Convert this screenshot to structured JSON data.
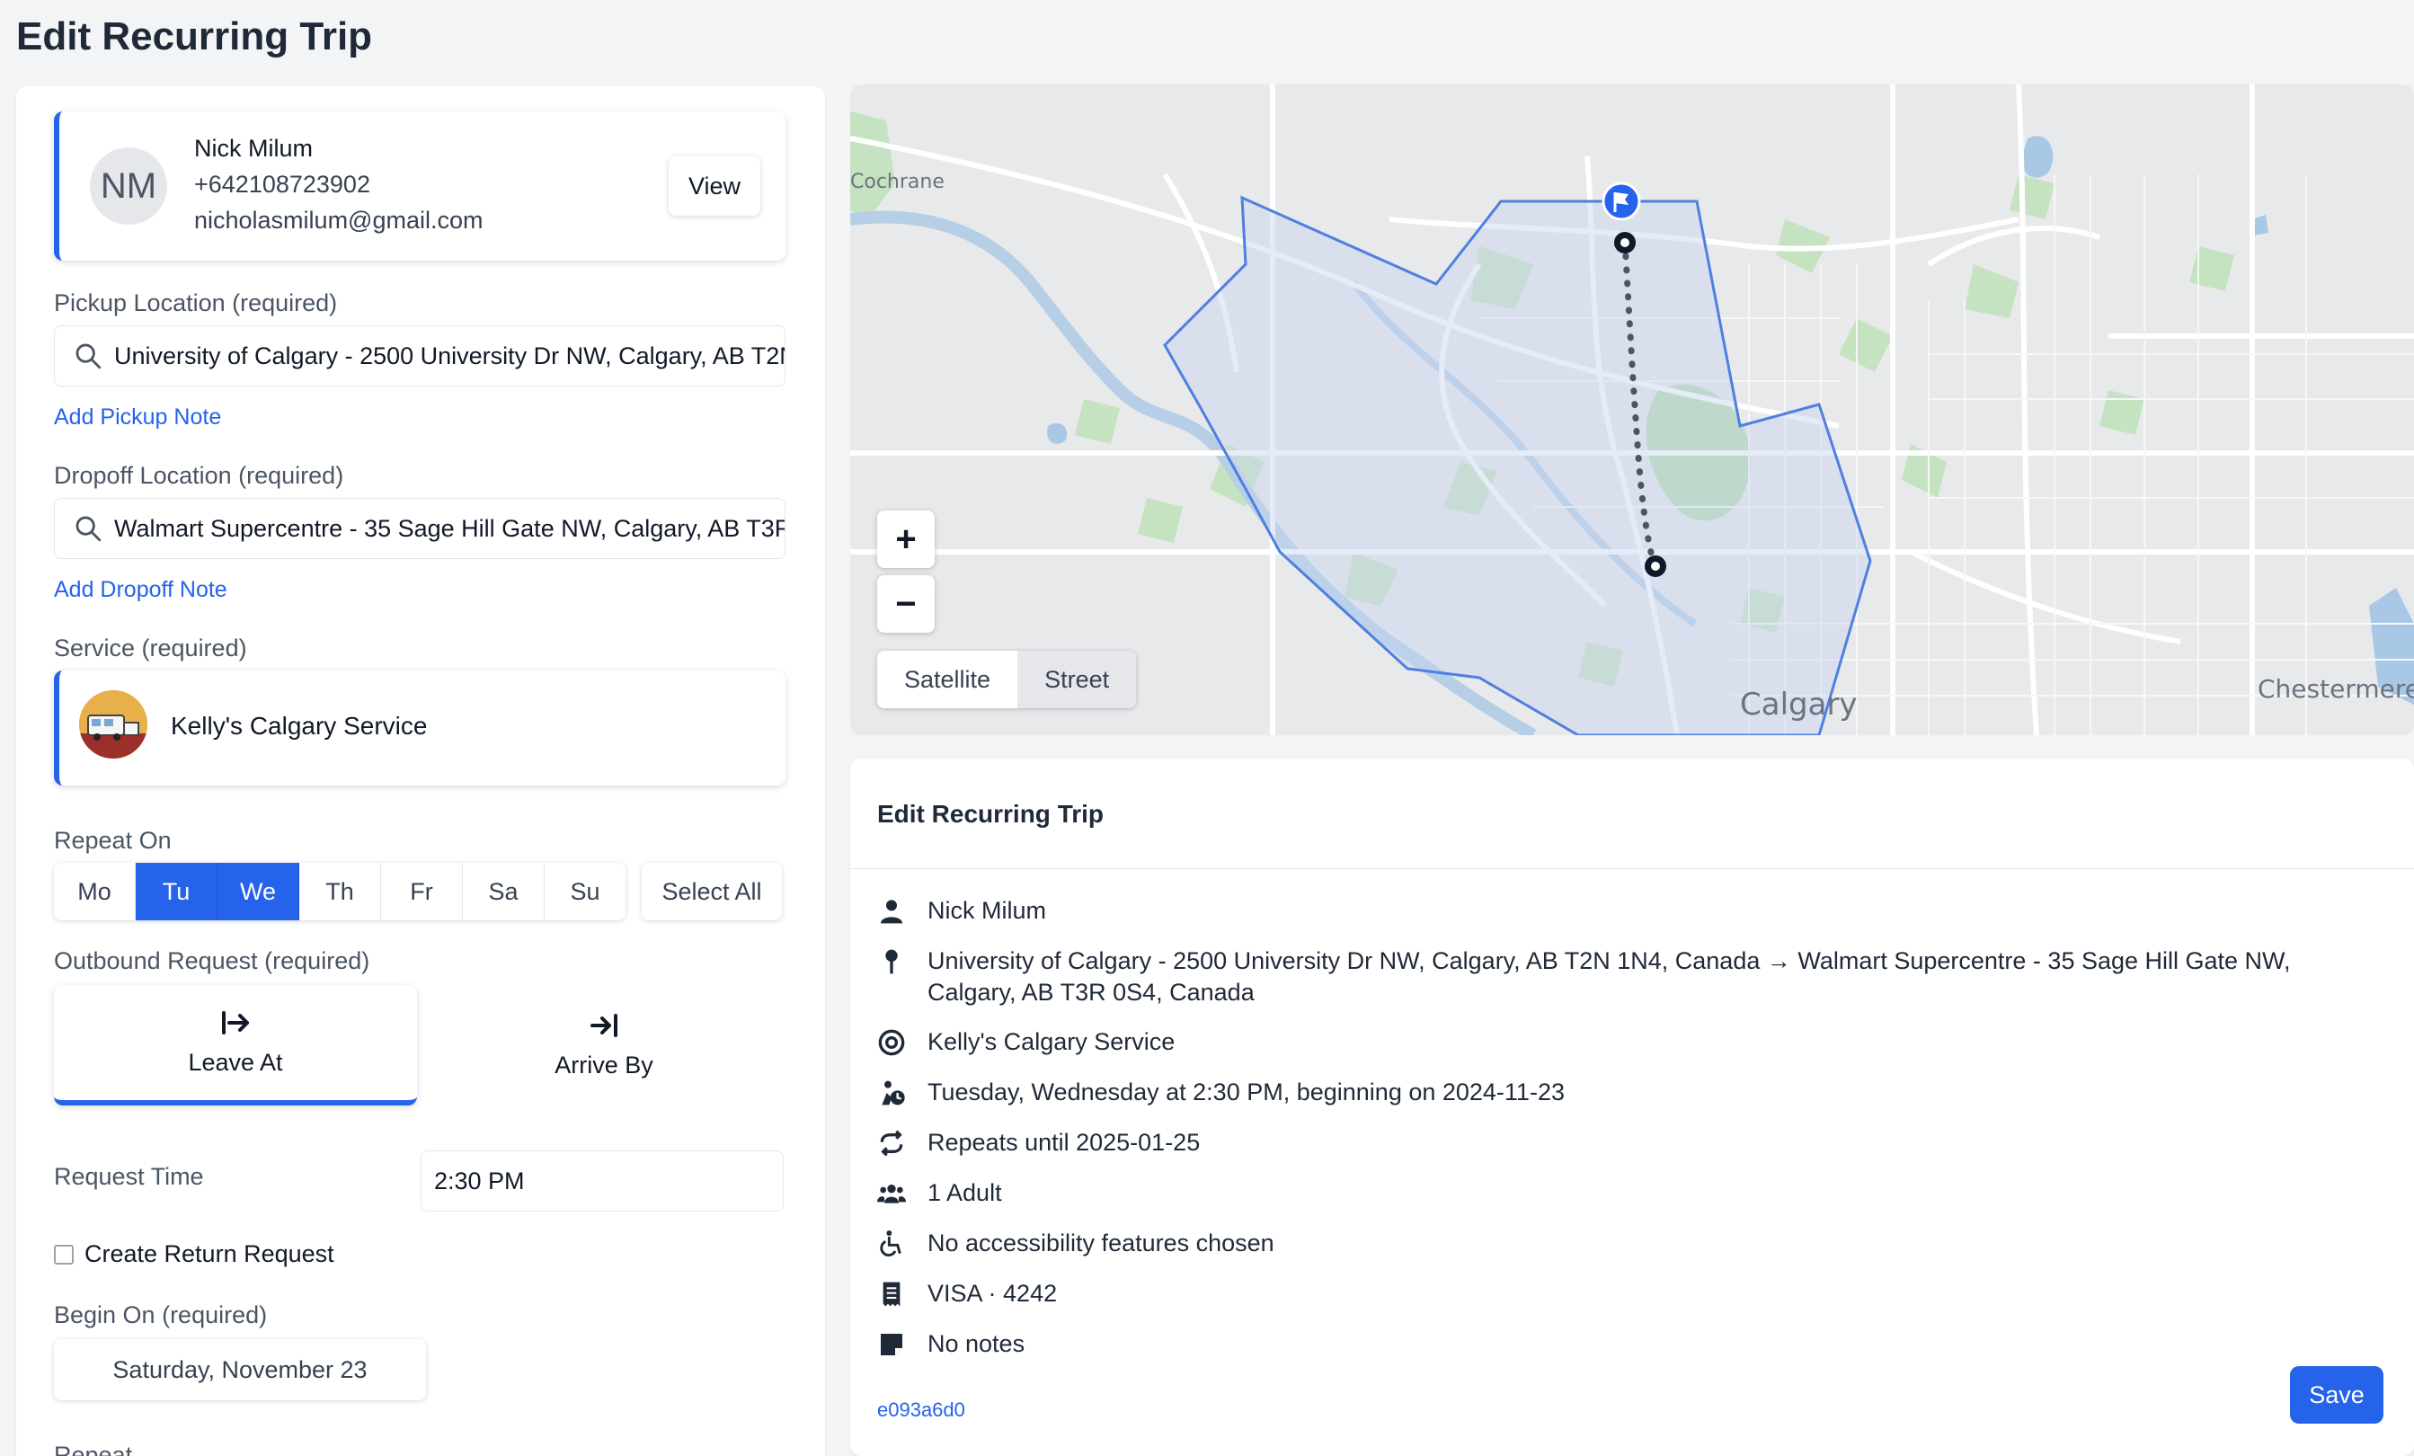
{
  "page": {
    "title": "Edit Recurring Trip"
  },
  "rider": {
    "initials": "NM",
    "name": "Nick Milum",
    "phone": "+642108723902",
    "email": "nicholasmilum@gmail.com",
    "view_label": "View"
  },
  "pickup": {
    "label": "Pickup Location (required)",
    "value": "University of Calgary - 2500 University Dr NW, Calgary, AB T2N 1N4, Canada",
    "note_link": "Add Pickup Note"
  },
  "dropoff": {
    "label": "Dropoff Location (required)",
    "value": "Walmart Supercentre - 35 Sage Hill Gate NW, Calgary, AB T3R 0S4, Canada",
    "note_link": "Add Dropoff Note"
  },
  "service": {
    "label": "Service (required)",
    "name": "Kelly's Calgary Service"
  },
  "repeat": {
    "label": "Repeat On",
    "days": [
      "Mo",
      "Tu",
      "We",
      "Th",
      "Fr",
      "Sa",
      "Su"
    ],
    "selected": [
      "Tu",
      "We"
    ],
    "select_all_label": "Select All"
  },
  "outbound": {
    "label": "Outbound Request (required)",
    "options": [
      "Leave At",
      "Arrive By"
    ],
    "selected": "Leave At"
  },
  "request_time": {
    "label": "Request Time",
    "value": "2:30 PM"
  },
  "return_request": {
    "label": "Create Return Request",
    "checked": false
  },
  "begin_on": {
    "label": "Begin On (required)",
    "value": "Saturday, November 23"
  },
  "repeat_bottom_label": "Repeat",
  "map": {
    "zoom_in": "+",
    "zoom_out": "−",
    "types": [
      "Satellite",
      "Street"
    ],
    "active_type": "Satellite",
    "places": {
      "cochrane": "Cochrane",
      "calgary": "Calgary",
      "chestermere": "Chestermere"
    }
  },
  "summary": {
    "title": "Edit Recurring Trip",
    "rider": "Nick Milum",
    "route": "University of Calgary - 2500 University Dr NW, Calgary, AB T2N 1N4, Canada → Walmart Supercentre - 35 Sage Hill Gate NW, Calgary, AB T3R 0S4, Canada",
    "service": "Kelly's Calgary Service",
    "schedule": "Tuesday, Wednesday at 2:30 PM, beginning on 2024-11-23",
    "repeats": "Repeats until 2025-01-25",
    "passengers": "1 Adult",
    "accessibility": "No accessibility features chosen",
    "payment": "VISA · 4242",
    "notes": "No notes",
    "trip_id": "e093a6d0",
    "save_label": "Save"
  },
  "colors": {
    "accent": "#2563eb",
    "zone_fill": "#c7d2f0",
    "zone_stroke": "#4f7fe0"
  },
  "icons": [
    "search-icon",
    "user-icon",
    "pin-icon",
    "target-icon",
    "schedule-icon",
    "repeat-icon",
    "users-icon",
    "wheelchair-icon",
    "receipt-icon",
    "note-icon",
    "flag-icon",
    "leave-at-icon",
    "arrive-by-icon"
  ]
}
